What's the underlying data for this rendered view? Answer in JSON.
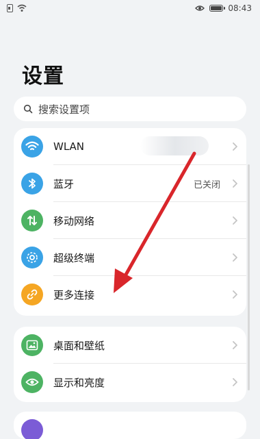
{
  "status_bar": {
    "time": "08:43"
  },
  "page": {
    "title": "设置"
  },
  "search": {
    "placeholder": "搜索设置项"
  },
  "group1": [
    {
      "label": "WLAN",
      "value": "",
      "icon": "wifi-icon",
      "color": "#3aa3e6"
    },
    {
      "label": "蓝牙",
      "value": "已关闭",
      "icon": "bluetooth-icon",
      "color": "#3aa3e6"
    },
    {
      "label": "移动网络",
      "value": "",
      "icon": "mobile-network-icon",
      "color": "#4db363"
    },
    {
      "label": "超级终端",
      "value": "",
      "icon": "super-device-icon",
      "color": "#3aa3e6"
    },
    {
      "label": "更多连接",
      "value": "",
      "icon": "link-icon",
      "color": "#f5a623"
    }
  ],
  "group2": [
    {
      "label": "桌面和壁纸",
      "value": "",
      "icon": "wallpaper-icon",
      "color": "#4db363"
    },
    {
      "label": "显示和亮度",
      "value": "",
      "icon": "display-eye-icon",
      "color": "#4db363"
    }
  ],
  "annotation": {
    "arrow_color": "#d9262b"
  }
}
